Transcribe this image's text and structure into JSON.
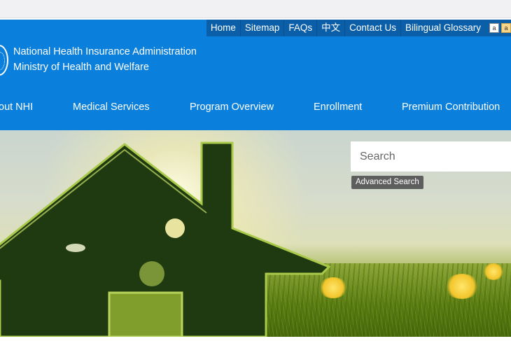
{
  "top_links": [
    "Home",
    "Sitemap",
    "FAQs",
    "中文",
    "Contact Us",
    "Bilingual Glossary"
  ],
  "font_size_buttons": [
    "a",
    "a"
  ],
  "organization": {
    "line1": "National Health Insurance Administration",
    "line2": "Ministry of Health and Welfare"
  },
  "main_nav": [
    "out NHI",
    "Medical Services",
    "Program Overview",
    "Enrollment",
    "Premium Contribution"
  ],
  "search": {
    "placeholder": "Search",
    "advanced_label": "Advanced Search"
  },
  "colors": {
    "header": "#0a7fdb",
    "top_links_bar": "#0b5fa8",
    "advanced_button": "#5e5e5e"
  },
  "icons": {
    "logo": "nhia-seal-icon"
  }
}
